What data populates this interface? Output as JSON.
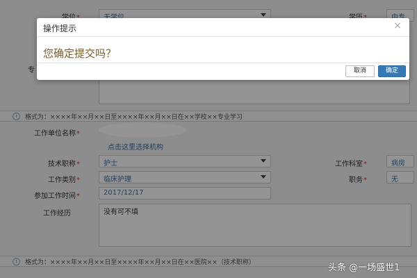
{
  "form": {
    "degree_label": "学位",
    "degree_value": "无学位",
    "education_label": "学历",
    "education_value": "中专",
    "major_label": "专",
    "study_tip": "格式为：××××年××月××日至××××年××月××日在××学校××专业学习",
    "work_unit_label": "工作单位名称",
    "select_org_link": "点击这里选择机构",
    "tech_title_label": "技术职称",
    "tech_title_value": "护士",
    "department_label": "工作科室",
    "department_value": "病房",
    "work_type_label": "工作类别",
    "work_type_value": "临床护理",
    "position_label": "职务",
    "position_value": "无",
    "start_date_label": "参加工作时间",
    "start_date_value": "2017/12/17",
    "experience_label": "工作经历",
    "experience_value": "没有可不填",
    "work_tip": "格式为：××××年××月××日至××××年××月××日在××医院××（技术职称）"
  },
  "dialog": {
    "title": "操作提示",
    "close_glyph": "×",
    "message": "您确定提交吗？",
    "cancel_label": "取消",
    "confirm_label": "确定"
  },
  "watermark": "头条 @一场盛世1",
  "icons": {
    "info": "i"
  },
  "colors": {
    "primary": "#337ab7",
    "required": "#e0312b",
    "link": "#3a6fa8"
  }
}
